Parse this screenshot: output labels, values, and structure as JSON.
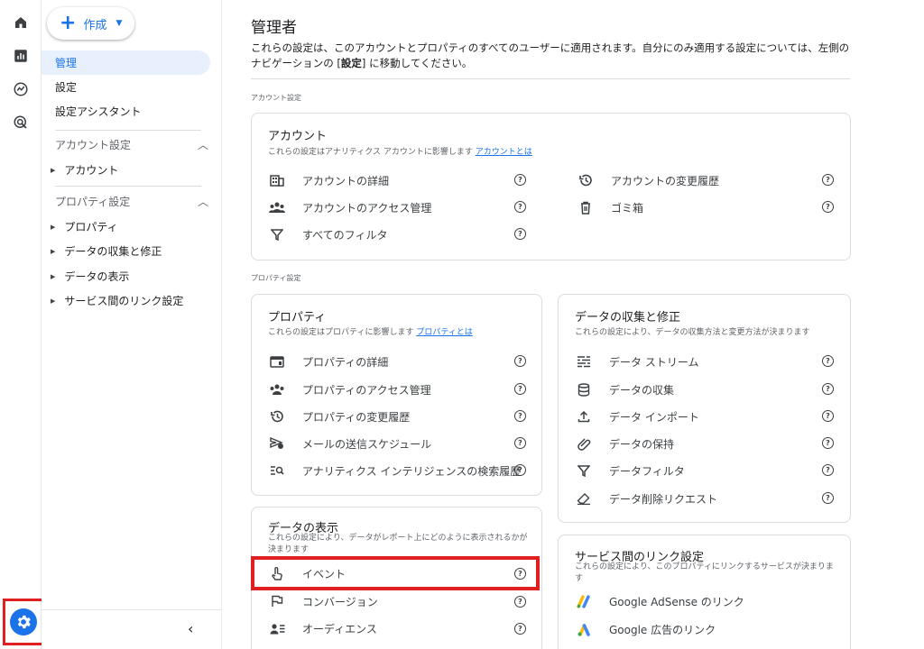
{
  "rail": {
    "icons": [
      "home-icon",
      "reports-icon",
      "explore-icon",
      "advertising-icon"
    ],
    "settings_icon": "gear-icon",
    "accent": "#1a73e8",
    "highlight": "#e02020"
  },
  "nav": {
    "create_label": "作成",
    "items": [
      {
        "label": "管理",
        "active": true
      },
      {
        "label": "設定"
      },
      {
        "label": "設定アシスタント"
      }
    ],
    "account_section": {
      "title": "アカウント設定",
      "items": [
        "アカウント"
      ]
    },
    "property_section": {
      "title": "プロパティ設定",
      "items": [
        "プロパティ",
        "データの収集と修正",
        "データの表示",
        "サービス間のリンク設定"
      ]
    },
    "collapse_icon": "chevron-left-icon"
  },
  "main": {
    "title": "管理者",
    "desc_part1": "これらの設定は、このアカウントとプロパティのすべてのユーザーに適用されます。自分にのみ適用する設定については、左側のナビゲーションの [",
    "desc_bold": "設定",
    "desc_part2": "] に移動してください。",
    "account_label": "アカウント設定",
    "property_label": "プロパティ設定",
    "account_card": {
      "title": "アカウント",
      "sub": "これらの設定はアナリティクス アカウントに影響します",
      "link": "アカウントとは",
      "left": [
        "アカウントの詳細",
        "アカウントのアクセス管理",
        "すべてのフィルタ"
      ],
      "right": [
        "アカウントの変更履歴",
        "ゴミ箱"
      ]
    },
    "property_card": {
      "title": "プロパティ",
      "sub": "これらの設定はプロパティに影響します",
      "link": "プロパティとは",
      "items": [
        "プロパティの詳細",
        "プロパティのアクセス管理",
        "プロパティの変更履歴",
        "メールの送信スケジュール",
        "アナリティクス インテリジェンスの検索履歴"
      ]
    },
    "collection_card": {
      "title": "データの収集と修正",
      "sub": "これらの設定により、データの収集方法と変更方法が決まります",
      "items": [
        "データ ストリーム",
        "データの収集",
        "データ インポート",
        "データの保持",
        "データフィルタ",
        "データ削除リクエスト"
      ]
    },
    "display_card": {
      "title": "データの表示",
      "sub": "これらの設定により、データがレポート上にどのように表示されるかが決まります",
      "items": [
        "イベント",
        "コンバージョン",
        "オーディエンス"
      ]
    },
    "links_card": {
      "title": "サービス間のリンク設定",
      "sub": "これらの設定により、このプロパティにリンクするサービスが決まります",
      "items": [
        "Google AdSense のリンク",
        "Google 広告のリンク"
      ]
    }
  }
}
